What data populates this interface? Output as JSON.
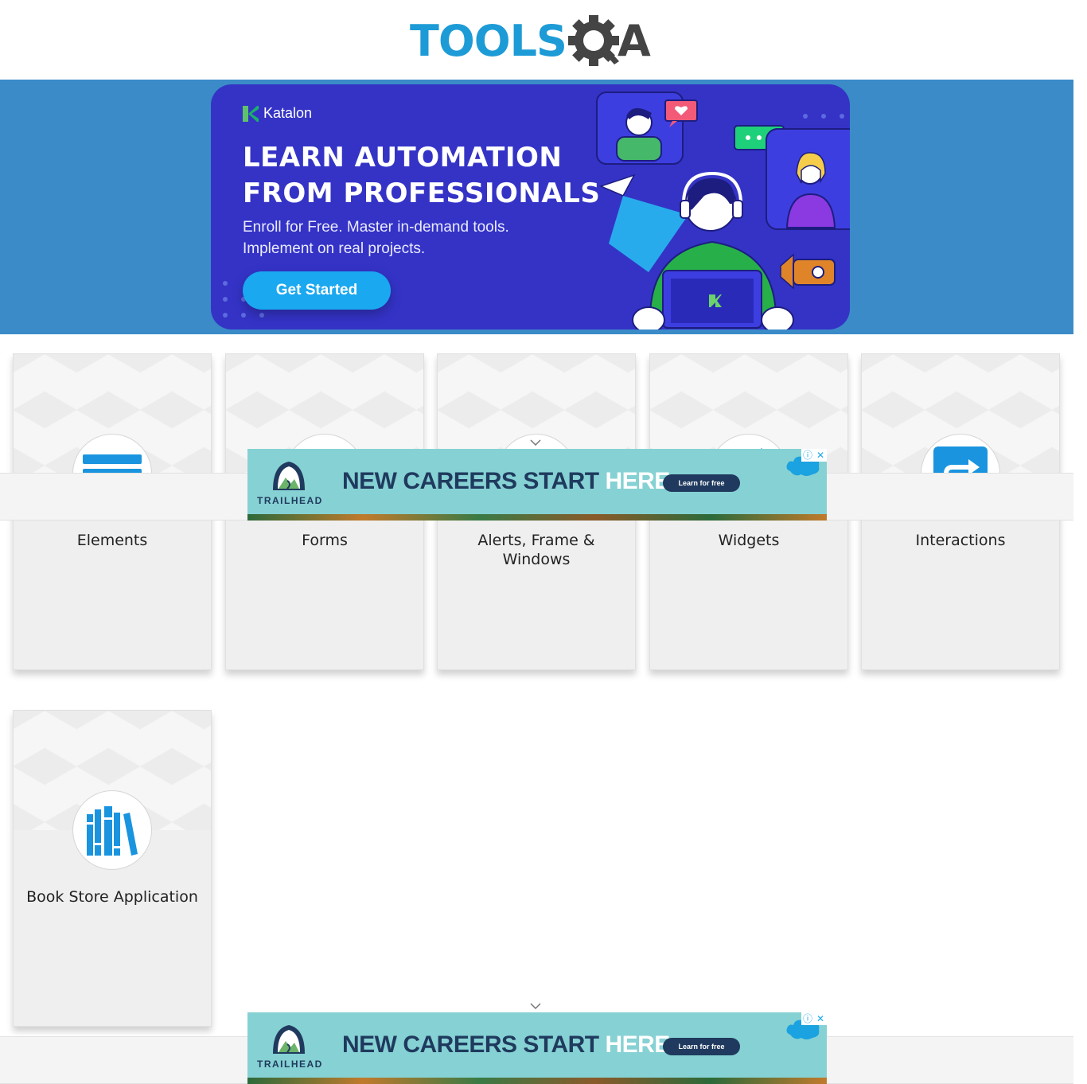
{
  "header": {
    "logo_text_tools": "TOOLS",
    "logo_text_qa": "A"
  },
  "banner": {
    "brand": "Katalon",
    "headline_line1": "LEARN AUTOMATION",
    "headline_line2": "FROM PROFESSIONALS",
    "sub_line1": "Enroll for Free. Master in-demand tools.",
    "sub_line2": "Implement on real projects.",
    "cta_label": "Get Started",
    "colors": {
      "strip": "#3a8bc7",
      "card": "#3433c6",
      "cta": "#1aa8f0"
    }
  },
  "cards": [
    {
      "label": "Elements",
      "icon": "list-icon"
    },
    {
      "label": "Forms",
      "icon": "form-icon"
    },
    {
      "label": "Alerts, Frame & Windows",
      "icon": "window-icon"
    },
    {
      "label": "Widgets",
      "icon": "widget-icon"
    },
    {
      "label": "Interactions",
      "icon": "share-arrow-icon"
    },
    {
      "label": "Book Store Application",
      "icon": "books-icon"
    }
  ],
  "ad": {
    "brand": "TRAILHEAD",
    "headline_main": "NEW CAREERS START ",
    "headline_highlight": "HERE.",
    "button_label": "Learn for free",
    "sponsor": "salesforce",
    "info_glyph": "ⓘ",
    "close_glyph": "✕"
  }
}
